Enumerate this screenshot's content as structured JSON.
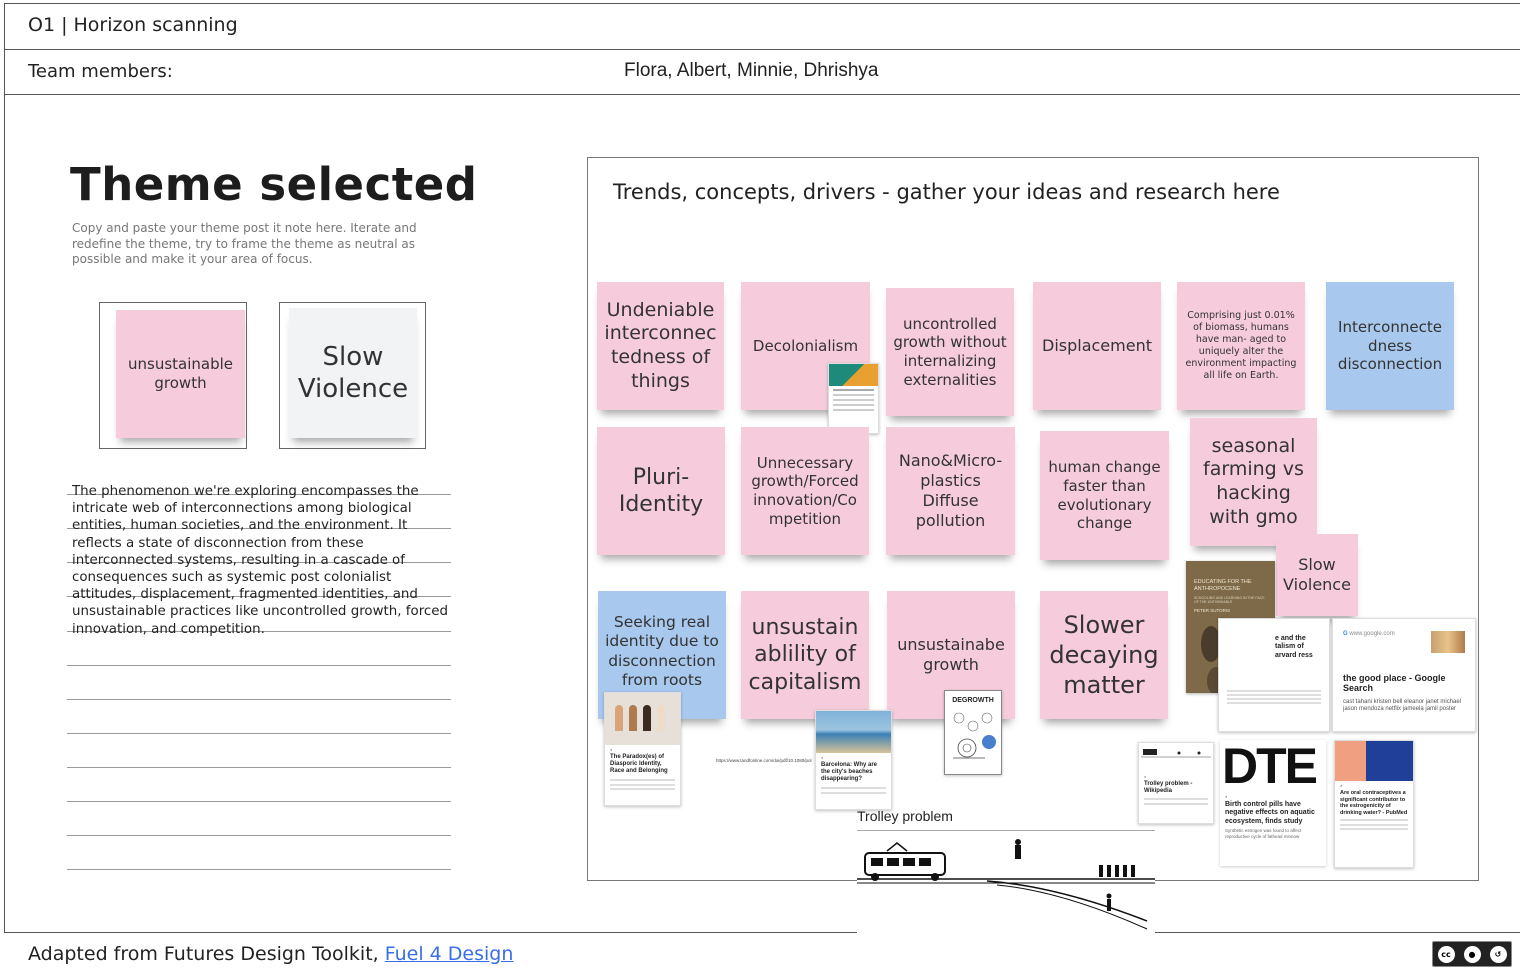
{
  "header": {
    "title": "O1 | Horizon scanning",
    "team_label": "Team members:",
    "team_value": "Flora, Albert, Minnie, Dhrishya"
  },
  "theme": {
    "heading": "Theme selected",
    "subtitle": "Copy and paste your theme post it note here. Iterate and redefine the theme, try to frame the theme as neutral as possible and make it your area of focus.",
    "notes": [
      "unsustainable growth",
      "Slow Violence"
    ],
    "description": "The phenomenon we're exploring encompasses the intricate web of interconnections among biological entities, human societies, and the environment. It reflects a state of disconnection from these interconnected systems, resulting in a cascade of consequences such as systemic post colonialist attitudes, displacement, fragmented identities, and unsustainable practices like uncontrolled growth, forced innovation, and competition."
  },
  "board": {
    "title": "Trends, concepts, drivers - gather your ideas and research here",
    "notes": [
      "Undeniable interconnec tedness of things",
      "Decolonialism",
      "uncontrolled growth without internalizing externalities",
      "Displacement",
      "Comprising just 0.01% of biomass, humans have man- aged to uniquely alter the environment impacting all life on Earth.",
      "Interconnecte dness disconnection",
      "Pluri- Identity",
      "Unnecessary growth/Forced innovation/Co mpetition",
      "Nano&Micro- plastics Diffuse pollution",
      "human change faster than evolutionary change",
      "seasonal farming vs hacking with gmo",
      "Slow Violence",
      "Seeking real identity due to disconnection from roots",
      "unsustain ablility of capitalism",
      "unsustainabe growth",
      "Slower decaying matter"
    ],
    "cards": {
      "diaspora_title": "The Paradox(es) of Diasporic Identity, Race and Belonging",
      "barcelona_title": "Barcelona: Why are the city's beaches disappearing?",
      "barcelona_url": "https://www.tandfonline.com/doi/pdf/10.1080/pol",
      "degrowth_label": "DEGROWTH",
      "book_title": "EDUCATING FOR THE ANTHROPOCENE",
      "book_sub": "SCHOOLING AND LEARNING IN THE FACE OF THE UNTHINKABLE",
      "book_author": "PETER SUTORIS",
      "slow_violence_card": "e and the talism of arvard ress",
      "google_site": "www.google.com",
      "google_title": "the good place - Google Search",
      "google_desc": "cast tahani kristen bell eleanor janet michael jason mendoza netflix jameela jamil poster",
      "trolley_card_title": "Trolley problem - Wikipedia",
      "dte_logo": "DTE",
      "dte_title": "Birth control pills have negative effects on aquatic ecosystem, finds study",
      "dte_desc": "Synthetic estrogen was found to affect reproductive cycle of fathead minnow",
      "pubmed_title": "Are oral contraceptives a significant contributor to the estrogenicity of drinking water? - PubMed",
      "trolley_label": "Trolley problem"
    }
  },
  "footer": {
    "text": "Adapted from Futures Design Toolkit,",
    "link": "Fuel 4 Design",
    "license": "cc"
  }
}
